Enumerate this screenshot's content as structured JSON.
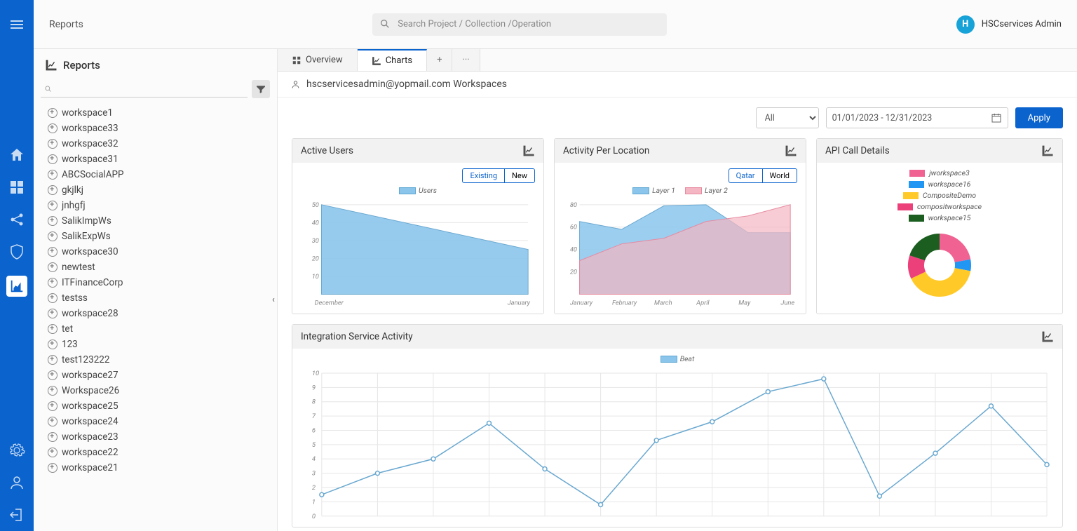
{
  "header": {
    "page_title": "Reports",
    "search_placeholder": "Search Project / Collection /Operation",
    "user_name": "HSCservices Admin",
    "avatar_letter": "H"
  },
  "sidebar": {
    "heading": "Reports",
    "items": [
      "workspace1",
      "workspace33",
      "workspace32",
      "workspace31",
      "ABCSocialAPP",
      "gkjlkj",
      "jnhgfj",
      "SalikImpWs",
      "SalikExpWs",
      "workspace30",
      "newtest",
      "ITFinanceCorp",
      "testss",
      "workspace28",
      "tet",
      "123",
      "test123222",
      "workspace27",
      "Workspace26",
      "workspace25",
      "workspace24",
      "workspace23",
      "workspace22",
      "workspace21"
    ]
  },
  "tabs": {
    "overview": "Overview",
    "charts": "Charts"
  },
  "breadcrumb": "hscservicesadmin@yopmail.com Workspaces",
  "filters": {
    "select_value": "All",
    "date_range": "01/01/2023 - 12/31/2023",
    "apply": "Apply"
  },
  "cards": {
    "active_users": {
      "title": "Active Users",
      "toggle": [
        "Existing",
        "New"
      ],
      "legend": "Users"
    },
    "activity_location": {
      "title": "Activity Per Location",
      "toggle": [
        "Qatar",
        "World"
      ],
      "legend": [
        "Layer 1",
        "Layer 2"
      ]
    },
    "api_calls": {
      "title": "API Call Details",
      "legend": [
        "jworkspace3",
        "workspace16",
        "CompositeDemo",
        "compositworkspace",
        "workspace15"
      ]
    },
    "integration": {
      "title": "Integration Service Activity",
      "legend": "Beat"
    }
  },
  "chart_data": [
    {
      "id": "active_users",
      "type": "area",
      "title": "Active Users",
      "categories": [
        "December",
        "January"
      ],
      "series": [
        {
          "name": "Users",
          "values": [
            50,
            25
          ]
        }
      ],
      "ylim": [
        0,
        50
      ],
      "yticks": [
        10,
        20,
        30,
        40,
        50
      ]
    },
    {
      "id": "activity_location",
      "type": "area",
      "title": "Activity Per Location",
      "categories": [
        "January",
        "February",
        "March",
        "April",
        "May",
        "June"
      ],
      "series": [
        {
          "name": "Layer 1",
          "values": [
            65,
            58,
            79,
            80,
            55,
            55
          ]
        },
        {
          "name": "Layer 2",
          "values": [
            30,
            45,
            50,
            65,
            70,
            80
          ]
        }
      ],
      "ylim": [
        0,
        80
      ],
      "yticks": [
        20,
        40,
        60,
        80
      ]
    },
    {
      "id": "api_calls",
      "type": "pie",
      "title": "API Call Details",
      "categories": [
        "jworkspace3",
        "workspace16",
        "CompositeDemo",
        "compositworkspace",
        "workspace15"
      ],
      "values": [
        22,
        6,
        40,
        12,
        20
      ],
      "colors": [
        "#f06292",
        "#2196f3",
        "#ffca28",
        "#ec407a",
        "#1b5e20"
      ]
    },
    {
      "id": "integration",
      "type": "line",
      "title": "Integration Service Activity",
      "x": [
        0,
        1,
        2,
        3,
        4,
        5,
        6,
        7,
        8,
        9,
        10,
        11,
        12
      ],
      "series": [
        {
          "name": "Beat",
          "values": [
            1.5,
            3,
            4,
            6.5,
            3.3,
            0.8,
            5.3,
            6.6,
            8.7,
            9.6,
            1.4,
            4.4,
            7.7,
            3.6
          ]
        }
      ],
      "ylim": [
        0,
        10
      ],
      "yticks": [
        0,
        1,
        2,
        3,
        4,
        5,
        6,
        7,
        8,
        9,
        10
      ]
    }
  ]
}
